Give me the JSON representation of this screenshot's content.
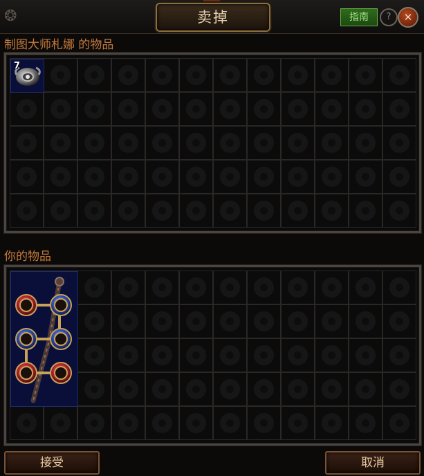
{
  "window": {
    "title": "卖掉",
    "guide_label": "指南",
    "close_label": "✕",
    "help_label": "?"
  },
  "vendor_section": {
    "label": "制图大师札娜 的物品",
    "items": [
      {
        "name": "orb-currency",
        "stack_count": "7"
      }
    ]
  },
  "player_section": {
    "label": "你的物品",
    "items": [
      {
        "name": "staff-with-sockets",
        "sockets": [
          "red",
          "blue",
          "blue",
          "blue",
          "red",
          "red"
        ]
      }
    ]
  },
  "buttons": {
    "accept": "接受",
    "cancel": "取消"
  },
  "colors": {
    "label": "#c67a3b",
    "socket_red": "#b3232a",
    "socket_blue": "#2d4fb3",
    "item_background": "#0a0f3a"
  }
}
